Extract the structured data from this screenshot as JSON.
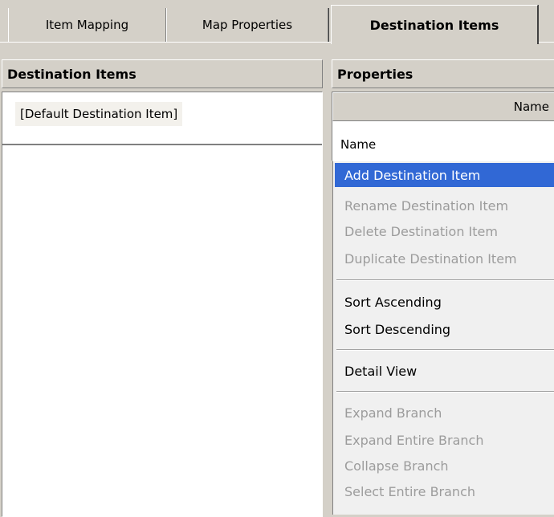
{
  "tabs": [
    {
      "label": "Item Mapping",
      "active": false
    },
    {
      "label": "Map Properties",
      "active": false
    },
    {
      "label": "Destination Items",
      "active": true
    }
  ],
  "left_panel": {
    "title": "Destination Items",
    "items": [
      "[Default Destination Item]"
    ]
  },
  "right_panel": {
    "title": "Properties",
    "column_header": "Name",
    "rows": [
      "Name"
    ]
  },
  "context_menu": {
    "groups": [
      [
        {
          "label": "Add Destination Item",
          "enabled": true,
          "highlighted": true
        },
        {
          "label": "Rename Destination Item",
          "enabled": false
        },
        {
          "label": "Delete Destination Item",
          "enabled": false
        },
        {
          "label": "Duplicate Destination Item",
          "enabled": false
        }
      ],
      [
        {
          "label": "Sort Ascending",
          "enabled": true
        },
        {
          "label": "Sort Descending",
          "enabled": true
        }
      ],
      [
        {
          "label": "Detail View",
          "enabled": true
        }
      ],
      [
        {
          "label": "Expand Branch",
          "enabled": false
        },
        {
          "label": "Expand Entire Branch",
          "enabled": false
        },
        {
          "label": "Collapse Branch",
          "enabled": false
        },
        {
          "label": "Select Entire Branch",
          "enabled": false
        }
      ]
    ]
  },
  "colors": {
    "face": "#d4d0c8",
    "highlight": "#3168d5",
    "disabled_text": "#9c9c9c"
  }
}
